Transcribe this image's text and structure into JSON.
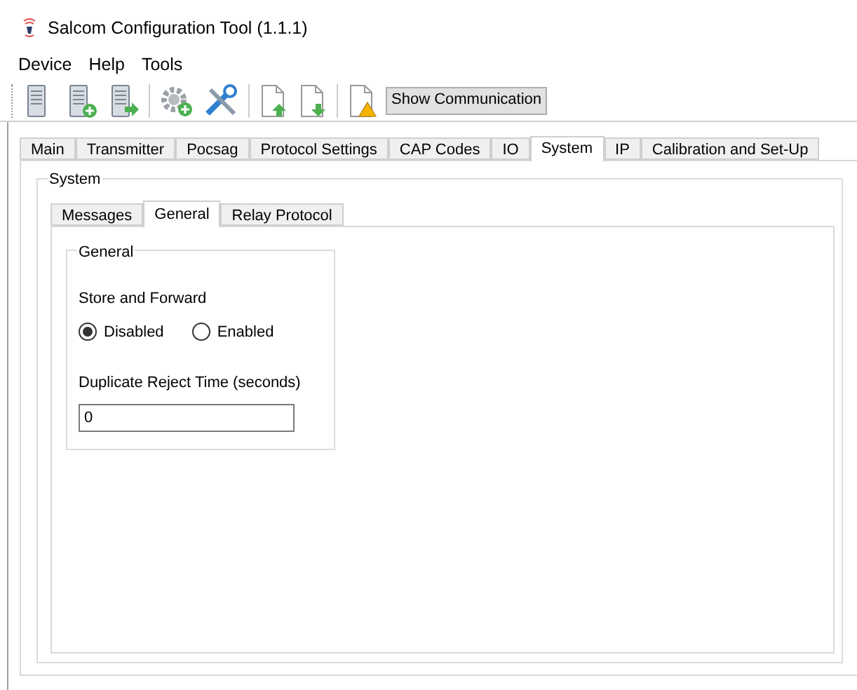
{
  "window": {
    "title": "Salcom Configuration Tool (1.1.1)"
  },
  "menu": [
    "Device",
    "Help",
    "Tools"
  ],
  "toolbar": {
    "show_communication": "Show Communication"
  },
  "tabs": [
    {
      "label": "Main",
      "selected": false
    },
    {
      "label": "Transmitter",
      "selected": false
    },
    {
      "label": "Pocsag",
      "selected": false
    },
    {
      "label": "Protocol Settings",
      "selected": false
    },
    {
      "label": "CAP Codes",
      "selected": false
    },
    {
      "label": "IO",
      "selected": false
    },
    {
      "label": "System",
      "selected": true
    },
    {
      "label": "IP",
      "selected": false
    },
    {
      "label": "Calibration and Set-Up",
      "selected": false
    }
  ],
  "system_group": {
    "title": "System",
    "tabs": [
      {
        "label": "Messages",
        "selected": false
      },
      {
        "label": "General",
        "selected": true
      },
      {
        "label": "Relay Protocol",
        "selected": false
      }
    ],
    "general_group": {
      "title": "General",
      "store_and_forward": {
        "label": "Store and Forward",
        "options": [
          {
            "label": "Disabled",
            "selected": true
          },
          {
            "label": "Enabled",
            "selected": false
          }
        ]
      },
      "duplicate_reject": {
        "label": "Duplicate Reject Time (seconds)",
        "value": "0"
      }
    }
  }
}
